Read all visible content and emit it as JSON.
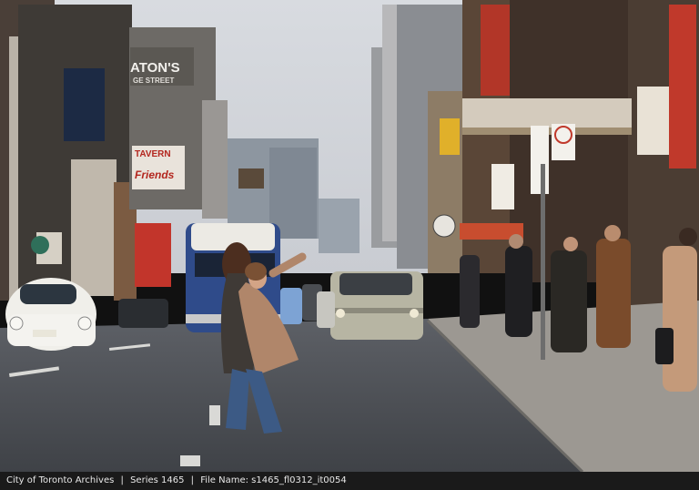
{
  "photo": {
    "signs": {
      "eatons_line1": "ATON'S",
      "eatons_line2": "GE STREET",
      "tavern_line1": "TAVERN",
      "tavern_line2": "Friends"
    }
  },
  "caption": {
    "archive": "City of Toronto Archives",
    "series": "Series 1465",
    "file_name": "File Name: s1465_fl0312_it0054",
    "separator": "|"
  }
}
